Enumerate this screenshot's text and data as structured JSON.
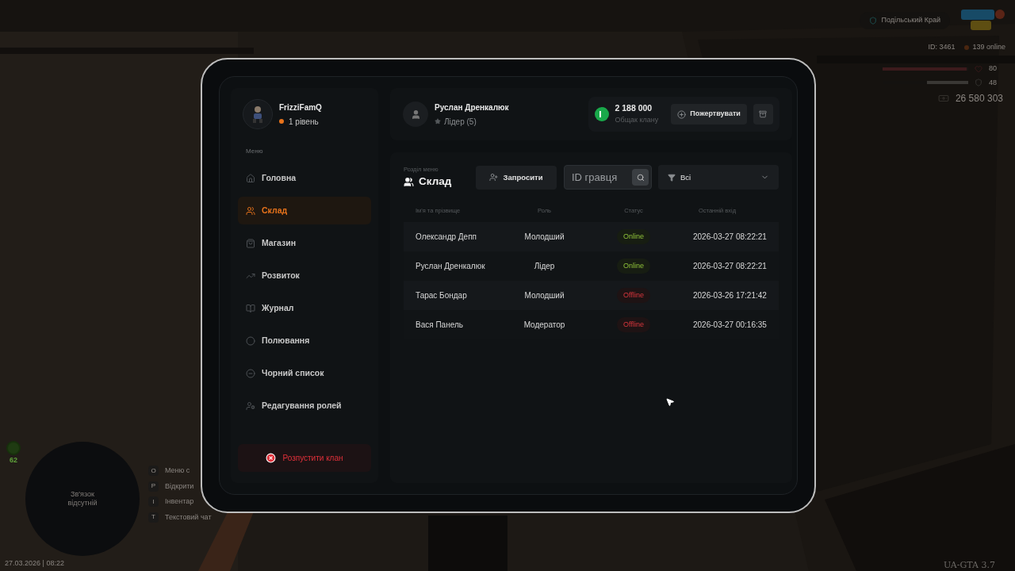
{
  "hud": {
    "region": "Подільський Край",
    "player_id": "ID: 3461",
    "online": "139 online",
    "health": {
      "value": "80",
      "level": 0.98
    },
    "armor": {
      "value": "48",
      "level": 0.48
    },
    "money": "26 580 303",
    "minimap_text": "Зв'язок відсутній",
    "level_badge": "62",
    "datetime": "27.03.2026 | 08:22",
    "version": "UA-GTA 3.7",
    "hotkeys": [
      {
        "key": "O",
        "label": "Меню с"
      },
      {
        "key": "P",
        "label": "Відкрити"
      },
      {
        "key": "I",
        "label": "Інвентар"
      },
      {
        "key": "T",
        "label": "Текстовий чат"
      }
    ]
  },
  "tablet": {
    "profile": {
      "name": "FrizziFamQ",
      "level": "1 рівень"
    },
    "menu_label": "Меню",
    "menu": [
      {
        "label": "Головна",
        "selected": false
      },
      {
        "label": "Склад",
        "selected": true
      },
      {
        "label": "Магазин",
        "selected": false
      },
      {
        "label": "Розвиток",
        "selected": false
      },
      {
        "label": "Журнал",
        "selected": false
      },
      {
        "label": "Полювання",
        "selected": false
      },
      {
        "label": "Чорний список",
        "selected": false
      },
      {
        "label": "Редагування ролей",
        "selected": false
      }
    ],
    "disband_button": "Розпустити клан",
    "user": {
      "name": "Руслан Дренкалюк",
      "role": "Лідер (5)"
    },
    "bank": {
      "amount": "2 188 000",
      "label": "Общак клану"
    },
    "donate_button": "Пожертвувати",
    "section": {
      "caption": "Розділ меню",
      "title": "Склад"
    },
    "invite_button": "Запросити",
    "search": {
      "placeholder": "ID гравця"
    },
    "filter": {
      "value": "Всі"
    },
    "table": {
      "columns": [
        "Ім'я та прізвище",
        "Роль",
        "Статус",
        "Останній вхід"
      ],
      "rows": [
        {
          "name": "Олександр Депп",
          "role": "Молодший",
          "status": "Online",
          "online": true,
          "last_login": "2026-03-27 08:22:21"
        },
        {
          "name": "Руслан Дренкалюк",
          "role": "Лідер",
          "status": "Online",
          "online": true,
          "last_login": "2026-03-27 08:22:21"
        },
        {
          "name": "Тарас Бондар",
          "role": "Молодший",
          "status": "Offline",
          "online": false,
          "last_login": "2026-03-26 17:21:42"
        },
        {
          "name": "Вася Панель",
          "role": "Модератор",
          "status": "Offline",
          "online": false,
          "last_login": "2026-03-27 00:16:35"
        }
      ]
    }
  }
}
